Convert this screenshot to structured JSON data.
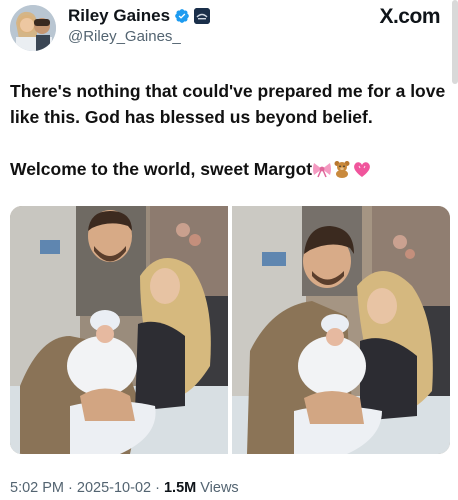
{
  "author": {
    "display_name": "Riley Gaines",
    "handle": "@Riley_Gaines_",
    "verified": true,
    "badge_color": "#1d9bf0"
  },
  "platform": {
    "logo_text": "X.com"
  },
  "tweet": {
    "line1": "There's nothing that could've prepared me for a love like this. God has blessed us beyond belief.",
    "line2": "Welcome to the world, sweet Margot",
    "emojis": [
      "bow-icon",
      "teddy-bear-icon",
      "sparkling-heart-icon"
    ]
  },
  "meta": {
    "time": "5:02 PM",
    "date": "2025-10-02",
    "separator": "·",
    "views_count": "1.5M",
    "views_label": "Views"
  },
  "media": {
    "count": 2,
    "photos": [
      "photo-1",
      "photo-2"
    ]
  }
}
